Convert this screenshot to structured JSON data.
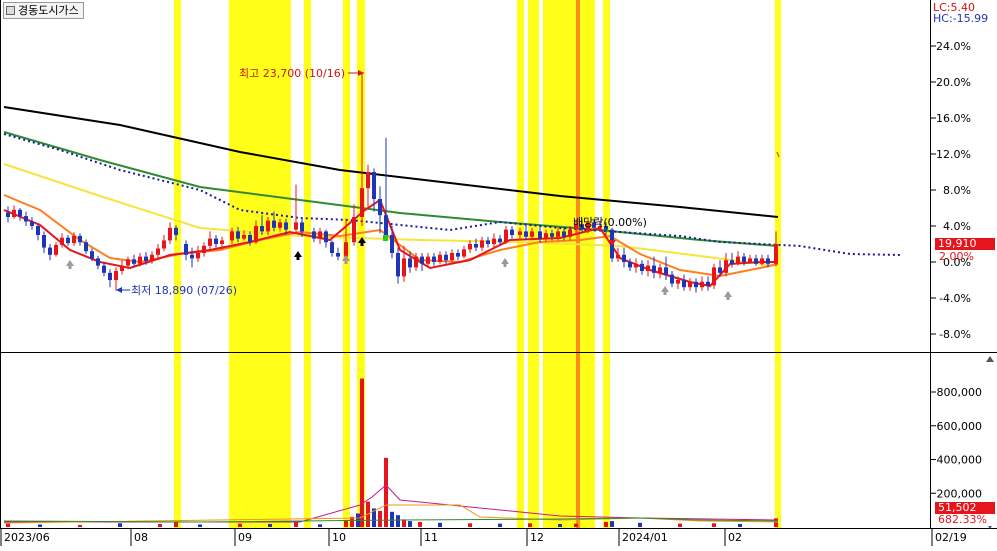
{
  "header": {
    "stock_name": "경동도시가스",
    "lc_label": "LC:5.40",
    "hc_label": "HC:-15.99"
  },
  "colors": {
    "highlight": "#ffff1a",
    "up": "#e8141b",
    "down": "#1f35b6",
    "ma_short": "#e8141b",
    "ma_mid": "#ff7f1f",
    "ma_long1": "#f5e63c",
    "ma_long2": "#2e8b2e",
    "ma_long3": "#000000",
    "ma_dotted": "#1a1a9a",
    "vol_line_pink": "#c81a8c",
    "vol_line_orange": "#e89a10",
    "vol_line_green": "#2e8b2e"
  },
  "chart_data": [
    {
      "type": "candlestick",
      "ylim_percent": [
        -10,
        26
      ],
      "y_ticks": [
        "24.0%",
        "20.0%",
        "16.0%",
        "12.0%",
        "8.0%",
        "4.0%",
        "0.0%",
        "-4.0%",
        "-8.0%"
      ],
      "last_price": "19,910",
      "last_pct": "2.00%",
      "annotations": {
        "high": "최고 23,700 (10/16)",
        "low": "최저 18,890 (07/26)",
        "dividend": "배당락(0.00%)"
      },
      "x_labels": [
        "2023/06",
        "08",
        "09",
        "10",
        "11",
        "12",
        "2024/01",
        "02",
        "02/19"
      ]
    },
    {
      "type": "bar",
      "title": "",
      "y_ticks": [
        "800,000",
        "600,000",
        "400,000",
        "200,000"
      ],
      "ylim": [
        0,
        1000000
      ],
      "last_volume": "51,502",
      "last_volume_pct": "682.33%"
    }
  ]
}
